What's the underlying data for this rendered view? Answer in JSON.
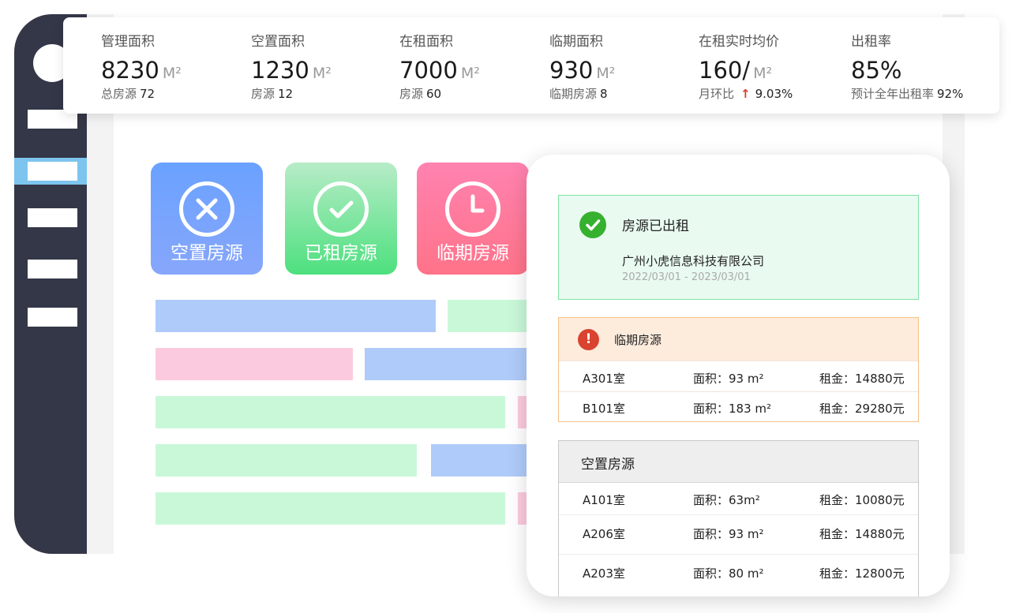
{
  "stats": [
    {
      "label": "管理面积",
      "value": "8230",
      "unit": "M²",
      "sub_label": "总房源",
      "sub_value": "72",
      "trend": ""
    },
    {
      "label": "空置面积",
      "value": "1230",
      "unit": "M²",
      "sub_label": "房源",
      "sub_value": "12",
      "trend": ""
    },
    {
      "label": "在租面积",
      "value": "7000",
      "unit": "M²",
      "sub_label": "房源",
      "sub_value": "60",
      "trend": ""
    },
    {
      "label": "临期面积",
      "value": "930",
      "unit": "M²",
      "sub_label": "临期房源",
      "sub_value": "8",
      "trend": ""
    },
    {
      "label": "在租实时均价",
      "value": "160/",
      "unit": "M²",
      "sub_label": "月环比",
      "sub_value": "9.03%",
      "trend": "↑"
    },
    {
      "label": "出租率",
      "value": "85%",
      "unit": "",
      "sub_label": "预计全年出租率",
      "sub_value": "92%",
      "trend": ""
    }
  ],
  "tiles": {
    "vacant": "空置房源",
    "rented": "已租房源",
    "expiring": "临期房源"
  },
  "detail": {
    "rented": {
      "title": "房源已出租",
      "company": "广州小虎信息科技有限公司",
      "period": "2022/03/01 - 2023/03/01"
    },
    "expiring": {
      "title": "临期房源",
      "warn_glyph": "!",
      "rows": [
        {
          "room": "A301室",
          "area": "面积：93 m²",
          "rent": "租金：14880元"
        },
        {
          "room": "B101室",
          "area": "面积：183 m²",
          "rent": "租金：29280元"
        }
      ]
    },
    "vacant": {
      "title": "空置房源",
      "rows": [
        {
          "room": "A101室",
          "area": "面积：63m²",
          "rent": "租金：10080元"
        },
        {
          "room": "A206室",
          "area": "面积：93 m²",
          "rent": "租金：14880元"
        },
        {
          "room": "A203室",
          "area": "面积：80 m²",
          "rent": "租金：12800元"
        }
      ]
    }
  },
  "colors": {
    "sidebar": "#343747",
    "sidebar_active": "#7dc4ef",
    "vacant_tile": "#6aa2ff",
    "rented_tile": "#4de07e",
    "expiring_tile": "#ff7389",
    "trend_up": "#e03a2c",
    "success": "#36b12f",
    "warning": "#d9432f"
  },
  "icons": {
    "vacant": "close-circle-icon",
    "rented": "check-circle-icon",
    "expiring": "clock-icon",
    "rented_status": "check-icon",
    "expiring_status": "exclamation-icon"
  }
}
